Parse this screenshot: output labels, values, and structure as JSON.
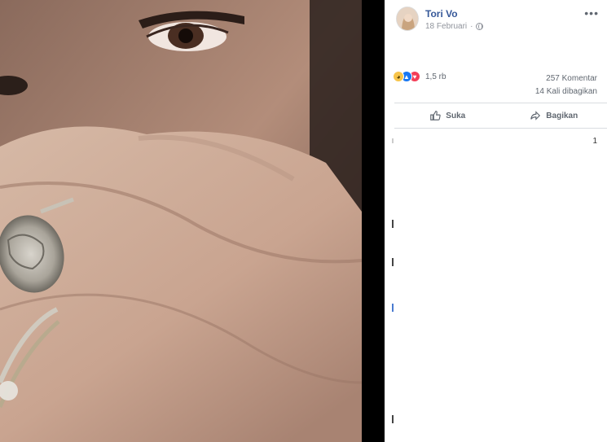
{
  "post": {
    "author": "Tori Vo",
    "date": "18 Februari",
    "privacy_icon": "globe-icon",
    "more_icon": "ellipsis-icon"
  },
  "reactions": {
    "icons": [
      "sad-reaction-icon",
      "like-reaction-icon",
      "love-reaction-icon"
    ],
    "count": "1,5 rb"
  },
  "stats": {
    "comments": "257 Komentar",
    "shares": "14 Kali dibagikan"
  },
  "actions": {
    "like_label": "Suka",
    "share_label": "Bagikan"
  },
  "comments": {
    "page_number": "1"
  },
  "colors": {
    "author_link": "#365899",
    "secondary_text": "#606770",
    "like_blue": "#1877f2",
    "love_red": "#f33e58",
    "sad_yellow": "#f7c44a"
  }
}
